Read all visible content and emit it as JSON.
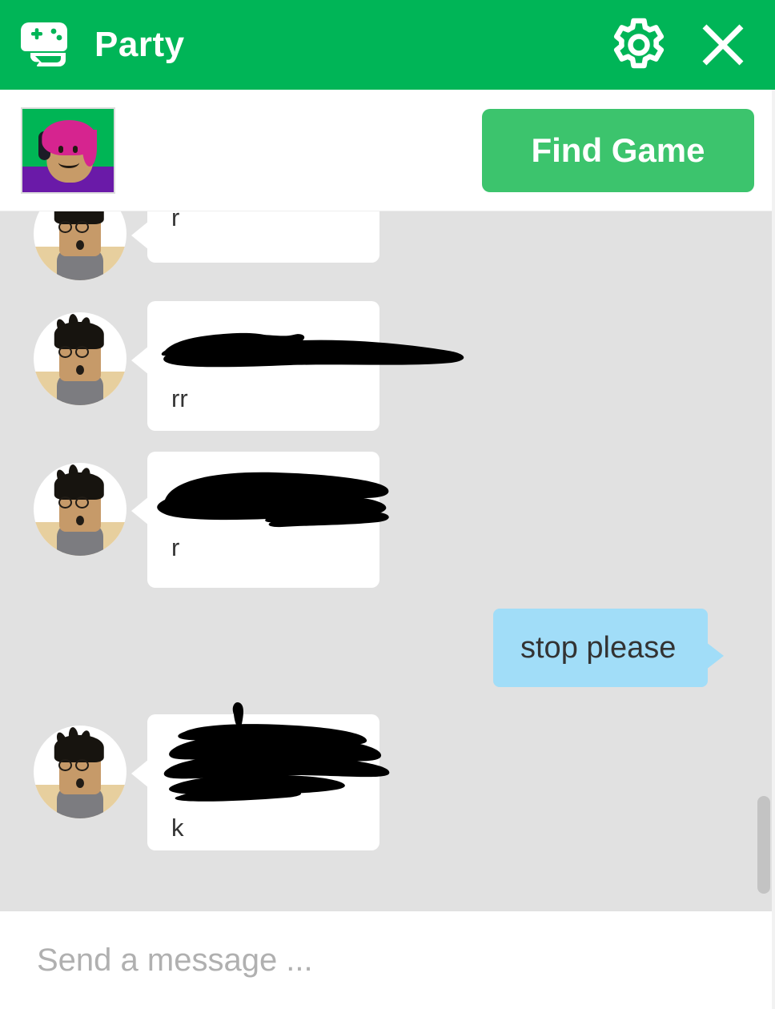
{
  "window": {
    "title": "Party",
    "header_color": "#00b557",
    "icons": {
      "party": "game-controller-chat-icon",
      "settings": "gear-icon",
      "close": "close-icon"
    }
  },
  "subheader": {
    "avatar_alt": "user-avatar-thumbnail",
    "find_game_label": "Find Game",
    "button_color": "#3cc46d"
  },
  "chat": {
    "background_color": "#e1e1e1",
    "incoming_bubble_color": "#ffffff",
    "outgoing_bubble_color": "#a1ddf8",
    "messages": [
      {
        "id": "msg-1",
        "direction": "incoming",
        "text": "r",
        "redacted": true,
        "partially_visible": true
      },
      {
        "id": "msg-2",
        "direction": "incoming",
        "text": "rr",
        "redacted": true,
        "partially_visible": false
      },
      {
        "id": "msg-3",
        "direction": "incoming",
        "text": "r",
        "redacted": true,
        "partially_visible": false
      },
      {
        "id": "msg-4",
        "direction": "outgoing",
        "text": "stop please",
        "redacted": false,
        "partially_visible": false
      },
      {
        "id": "msg-5",
        "direction": "incoming",
        "text": "k",
        "redacted": true,
        "partially_visible": false
      }
    ]
  },
  "composer": {
    "placeholder": "Send a message ...",
    "value": ""
  }
}
